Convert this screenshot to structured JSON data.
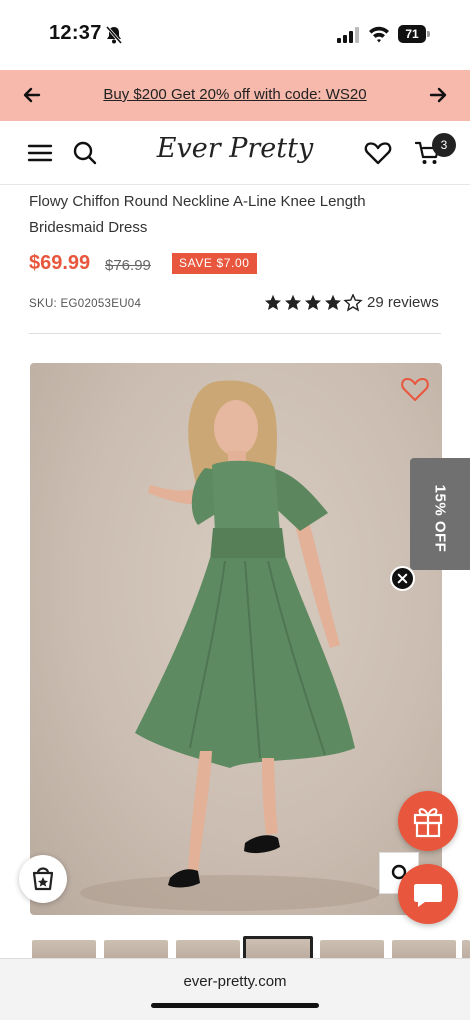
{
  "status_bar": {
    "time": "12:37",
    "battery_level": "71"
  },
  "promo_banner": {
    "text": "Buy $200 Get 20% off with code: WS20"
  },
  "header": {
    "logo": "Ever Pretty",
    "cart_count": "3"
  },
  "product": {
    "title": "Flowy Chiffon Round Neckline A-Line Knee Length Bridesmaid Dress",
    "price": "$69.99",
    "compare_price": "$76.99",
    "save_label": "SAVE $7.00",
    "sku": "SKU: EG02053EU04",
    "rating": 4.5,
    "reviews_label": "29 reviews"
  },
  "promo_tab": {
    "label": "15% OFF"
  },
  "browser": {
    "url": "ever-pretty.com"
  },
  "colors": {
    "accent": "#e8573d",
    "banner": "#f6b9ac",
    "dress": "#5e8a61"
  }
}
